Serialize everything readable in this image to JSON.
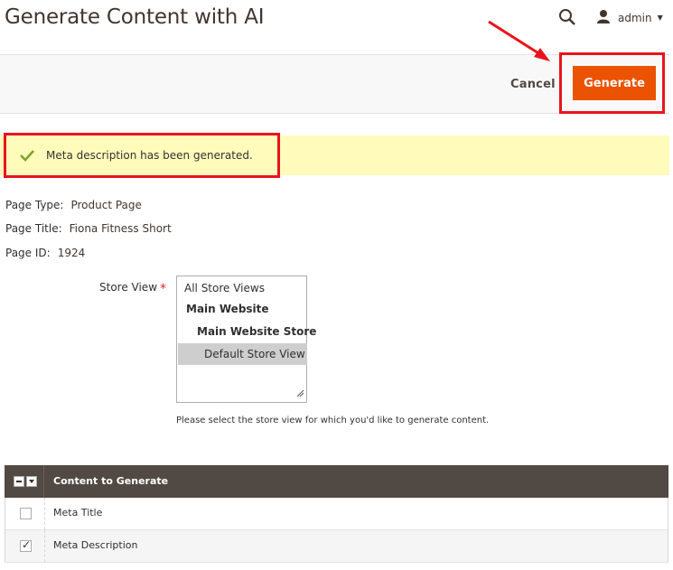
{
  "header": {
    "title": "Generate Content with AI",
    "user": "admin"
  },
  "actions": {
    "cancel_label": "Cancel",
    "generate_label": "Generate"
  },
  "message": {
    "text": "Meta description has been generated.",
    "type": "success"
  },
  "info": {
    "page_type_label": "Page Type:",
    "page_type_value": "Product Page",
    "page_title_label": "Page Title:",
    "page_title_value": "Fiona Fitness Short",
    "page_id_label": "Page ID:",
    "page_id_value": "1924"
  },
  "store_view": {
    "label": "Store View",
    "required_mark": "*",
    "options": [
      "All Store Views",
      "Main Website",
      "Main Website Store",
      "Default Store View"
    ],
    "selected": "Default Store View",
    "hint": "Please select the store view for which you'd like to generate content."
  },
  "grid": {
    "header": "Content to Generate",
    "rows": [
      {
        "label": "Meta Title",
        "checked": false
      },
      {
        "label": "Meta Description",
        "checked": true
      }
    ]
  },
  "colors": {
    "accent": "#eb5202",
    "annotation": "#e8141c",
    "message_bg": "#fffbbb",
    "grid_header_bg": "#514943"
  }
}
